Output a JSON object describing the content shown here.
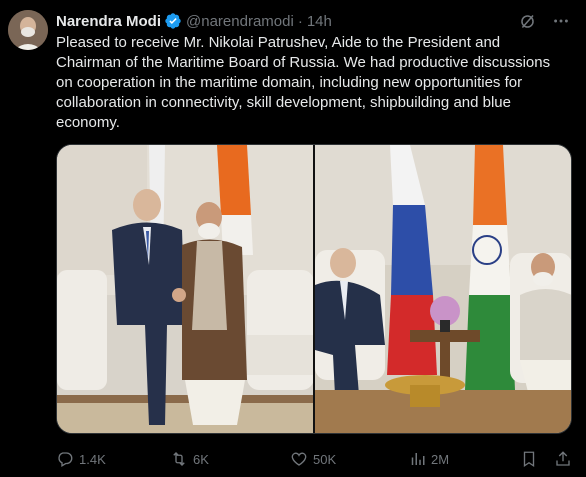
{
  "author": {
    "name": "Narendra Modi",
    "handle": "@narendramodi",
    "separator": "·",
    "time": "14h"
  },
  "tweet": {
    "text": "Pleased to receive Mr. Nikolai Patrushev, Aide to the President and Chairman of the Maritime Board of Russia. We had productive discussions on cooperation in the maritime domain, including new opportunities for collaboration in connectivity, skill development, shipbuilding and blue economy."
  },
  "header_icons": [
    "grok-icon",
    "more-icon"
  ],
  "actions": {
    "replies": "1.4K",
    "reposts": "6K",
    "likes": "50K",
    "views": "2M"
  },
  "colors": {
    "background": "#000000",
    "text": "#e7e9ea",
    "muted": "#71767b",
    "verified": "#1d9bf0"
  }
}
